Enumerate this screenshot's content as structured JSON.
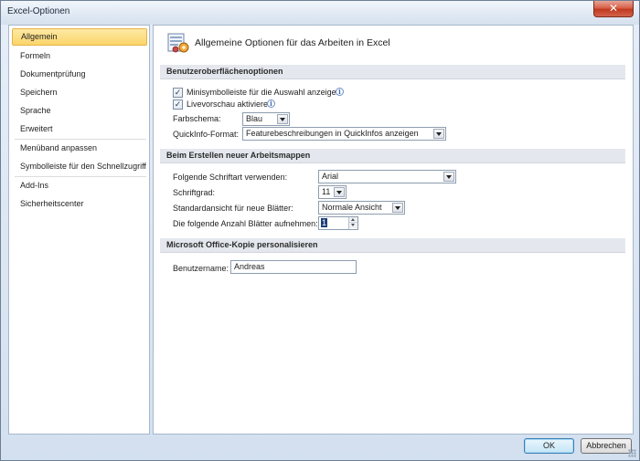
{
  "window": {
    "title": "Excel-Optionen",
    "close_glyph": "✕"
  },
  "sidebar": {
    "items": [
      {
        "label": "Allgemein",
        "selected": true
      },
      {
        "label": "Formeln"
      },
      {
        "label": "Dokumentprüfung"
      },
      {
        "label": "Speichern"
      },
      {
        "label": "Sprache"
      },
      {
        "label": "Erweitert"
      },
      {
        "label": "Menüband anpassen"
      },
      {
        "label": "Symbolleiste für den Schnellzugriff"
      },
      {
        "label": "Add-Ins"
      },
      {
        "label": "Sicherheitscenter"
      }
    ]
  },
  "header": {
    "icon": "general-options-icon",
    "title": "Allgemeine Optionen für das Arbeiten in Excel"
  },
  "ui_options": {
    "section_title": "Benutzeroberflächenoptionen",
    "mini_toolbar_label": "Minisymbolleiste für die Auswahl anzeigen",
    "mini_toolbar_checked": true,
    "live_preview_label": "Livevorschau aktivieren",
    "live_preview_checked": true,
    "color_scheme_label": "Farbschema:",
    "color_scheme_value": "Blau",
    "screentip_label": "QuickInfo-Format:",
    "screentip_value": "Featurebeschreibungen in QuickInfos anzeigen",
    "check_glyph": "✓",
    "info_glyph": "i"
  },
  "new_workbooks": {
    "section_title": "Beim Erstellen neuer Arbeitsmappen",
    "font_label": "Folgende Schriftart verwenden:",
    "font_value": "Arial",
    "font_size_label": "Schriftgrad:",
    "font_size_value": "11",
    "default_view_label": "Standardansicht für neue Blätter:",
    "default_view_value": "Normale Ansicht",
    "sheets_label": "Die folgende Anzahl Blätter aufnehmen:",
    "sheets_value": "1"
  },
  "personalize": {
    "section_title": "Microsoft Office-Kopie personalisieren",
    "username_label": "Benutzername:",
    "username_value": "Andreas"
  },
  "footer": {
    "ok_label": "OK",
    "cancel_label": "Abbrechen"
  }
}
